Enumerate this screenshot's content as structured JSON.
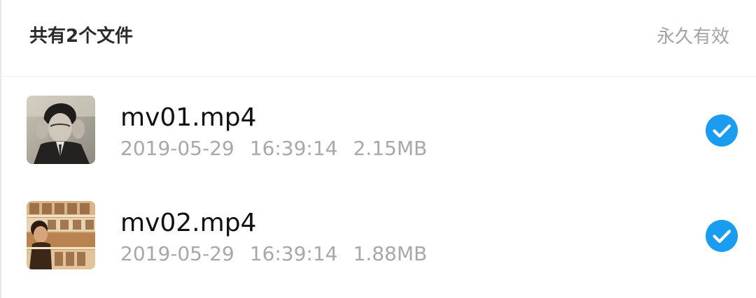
{
  "header": {
    "title": "共有2个文件",
    "validity": "永久有效"
  },
  "files": [
    {
      "name": "mv01.mp4",
      "date": "2019-05-29",
      "time": "16:39:14",
      "size": "2.15MB",
      "selected": true,
      "thumbnail": "portrait-photo-grayscale"
    },
    {
      "name": "mv02.mp4",
      "date": "2019-05-29",
      "time": "16:39:14",
      "size": "1.88MB",
      "selected": true,
      "thumbnail": "film-strip-collage"
    }
  ],
  "colors": {
    "check": "#1a9cf0",
    "title": "#2b2b2b",
    "muted": "#a8a8a8"
  }
}
